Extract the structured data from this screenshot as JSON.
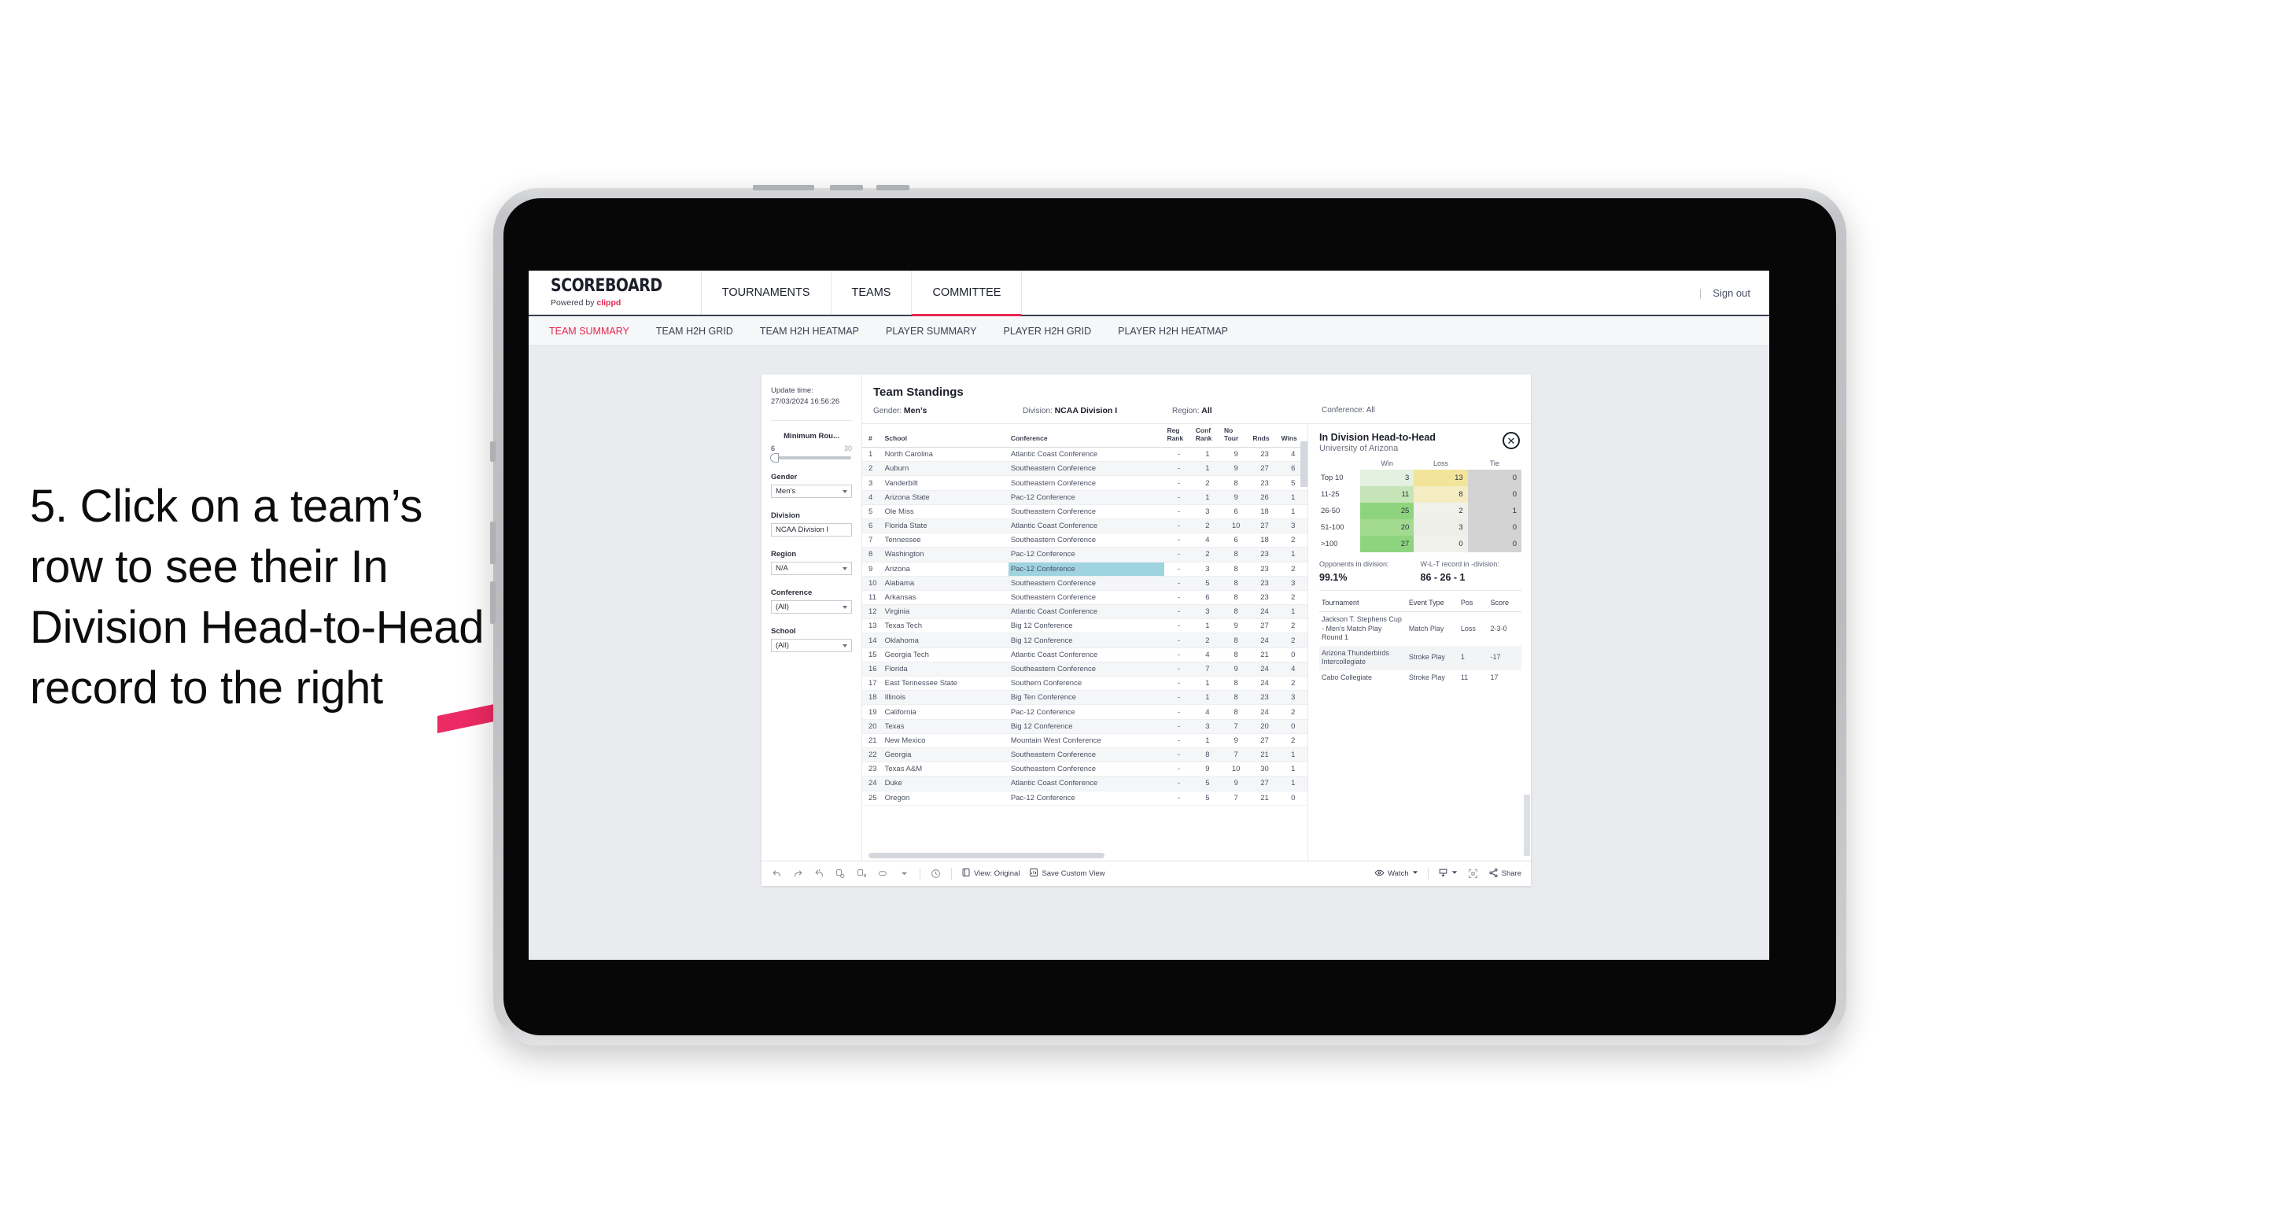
{
  "annotation": {
    "text": "5. Click on a team’s row to see their In Division Head-to-Head record to the right",
    "arrow_color": "#ec2a63"
  },
  "header": {
    "brand_name": "SCOREBOARD",
    "brand_sub_prefix": "Powered by ",
    "brand_sub_accent": "clippd",
    "nav": [
      {
        "label": "TOURNAMENTS",
        "active": false
      },
      {
        "label": "TEAMS",
        "active": false
      },
      {
        "label": "COMMITTEE",
        "active": true
      }
    ],
    "divider": "|",
    "signout": "Sign out",
    "accent_color": "#e8264f"
  },
  "subnav": [
    {
      "label": "TEAM SUMMARY",
      "active": true
    },
    {
      "label": "TEAM H2H GRID",
      "active": false
    },
    {
      "label": "TEAM H2H HEATMAP",
      "active": false
    },
    {
      "label": "PLAYER SUMMARY",
      "active": false
    },
    {
      "label": "PLAYER H2H GRID",
      "active": false
    },
    {
      "label": "PLAYER H2H HEATMAP",
      "active": false
    }
  ],
  "filters": {
    "update_time_label": "Update time:",
    "update_time_value": "27/03/2024 16:56:26",
    "slider": {
      "title": "Minimum Rou...",
      "min": "6",
      "max": "30"
    },
    "fields": [
      {
        "label": "Gender",
        "value": "Men’s"
      },
      {
        "label": "Division",
        "value": "NCAA Division I"
      },
      {
        "label": "Region",
        "value": "N/A"
      },
      {
        "label": "Conference",
        "value": "(All)"
      },
      {
        "label": "School",
        "value": "(All)"
      }
    ]
  },
  "standings": {
    "title": "Team Standings",
    "subfilters": [
      {
        "label": "Gender:",
        "value": "Men’s"
      },
      {
        "label": "Division:",
        "value": "NCAA Division I"
      },
      {
        "label": "Region:",
        "value": "All"
      },
      {
        "label": "Conference:",
        "value": "All"
      }
    ],
    "columns": [
      "#",
      "School",
      "Conference",
      "Reg Rank",
      "Conf Rank",
      "No Tour",
      "Rnds",
      "Wins"
    ],
    "rows": [
      [
        "1",
        "North Carolina",
        "Atlantic Coast Conference",
        "-",
        "1",
        "9",
        "23",
        "4"
      ],
      [
        "2",
        "Auburn",
        "Southeastern Conference",
        "-",
        "1",
        "9",
        "27",
        "6"
      ],
      [
        "3",
        "Vanderbilt",
        "Southeastern Conference",
        "-",
        "2",
        "8",
        "23",
        "5"
      ],
      [
        "4",
        "Arizona State",
        "Pac-12 Conference",
        "-",
        "1",
        "9",
        "26",
        "1"
      ],
      [
        "5",
        "Ole Miss",
        "Southeastern Conference",
        "-",
        "3",
        "6",
        "18",
        "1"
      ],
      [
        "6",
        "Florida State",
        "Atlantic Coast Conference",
        "-",
        "2",
        "10",
        "27",
        "3"
      ],
      [
        "7",
        "Tennessee",
        "Southeastern Conference",
        "-",
        "4",
        "6",
        "18",
        "2"
      ],
      [
        "8",
        "Washington",
        "Pac-12 Conference",
        "-",
        "2",
        "8",
        "23",
        "1"
      ],
      [
        "9",
        "Arizona",
        "Pac-12 Conference",
        "-",
        "3",
        "8",
        "23",
        "2"
      ],
      [
        "10",
        "Alabama",
        "Southeastern Conference",
        "-",
        "5",
        "8",
        "23",
        "3"
      ],
      [
        "11",
        "Arkansas",
        "Southeastern Conference",
        "-",
        "6",
        "8",
        "23",
        "2"
      ],
      [
        "12",
        "Virginia",
        "Atlantic Coast Conference",
        "-",
        "3",
        "8",
        "24",
        "1"
      ],
      [
        "13",
        "Texas Tech",
        "Big 12 Conference",
        "-",
        "1",
        "9",
        "27",
        "2"
      ],
      [
        "14",
        "Oklahoma",
        "Big 12 Conference",
        "-",
        "2",
        "8",
        "24",
        "2"
      ],
      [
        "15",
        "Georgia Tech",
        "Atlantic Coast Conference",
        "-",
        "4",
        "8",
        "21",
        "0"
      ],
      [
        "16",
        "Florida",
        "Southeastern Conference",
        "-",
        "7",
        "9",
        "24",
        "4"
      ],
      [
        "17",
        "East Tennessee State",
        "Southern Conference",
        "-",
        "1",
        "8",
        "24",
        "2"
      ],
      [
        "18",
        "Illinois",
        "Big Ten Conference",
        "-",
        "1",
        "8",
        "23",
        "3"
      ],
      [
        "19",
        "California",
        "Pac-12 Conference",
        "-",
        "4",
        "8",
        "24",
        "2"
      ],
      [
        "20",
        "Texas",
        "Big 12 Conference",
        "-",
        "3",
        "7",
        "20",
        "0"
      ],
      [
        "21",
        "New Mexico",
        "Mountain West Conference",
        "-",
        "1",
        "9",
        "27",
        "2"
      ],
      [
        "22",
        "Georgia",
        "Southeastern Conference",
        "-",
        "8",
        "7",
        "21",
        "1"
      ],
      [
        "23",
        "Texas A&M",
        "Southeastern Conference",
        "-",
        "9",
        "10",
        "30",
        "1"
      ],
      [
        "24",
        "Duke",
        "Atlantic Coast Conference",
        "-",
        "5",
        "9",
        "27",
        "1"
      ],
      [
        "25",
        "Oregon",
        "Pac-12 Conference",
        "-",
        "5",
        "7",
        "21",
        "0"
      ]
    ],
    "selected_row_index": 8,
    "highlight_color": "#9fd3e0"
  },
  "h2h": {
    "title": "In Division Head-to-Head",
    "subtitle": "University of Arizona",
    "close_icon": "close-icon",
    "columns": [
      "",
      "Win",
      "Loss",
      "Tie"
    ],
    "rows": [
      {
        "band": "Top 10",
        "win": "3",
        "loss": "13",
        "tie": "0",
        "win_color": "#e4f0e0",
        "loss_color": "#f2e49a",
        "tie_color": "#d3d3d3"
      },
      {
        "band": "11-25",
        "win": "11",
        "loss": "8",
        "tie": "0",
        "win_color": "#c5e5b8",
        "loss_color": "#f5ecc4",
        "tie_color": "#d3d3d3"
      },
      {
        "band": "26-50",
        "win": "25",
        "loss": "2",
        "tie": "1",
        "win_color": "#8ed47e",
        "loss_color": "#f1f1ec",
        "tie_color": "#d3d3d3"
      },
      {
        "band": "51-100",
        "win": "20",
        "loss": "3",
        "tie": "0",
        "win_color": "#a2da90",
        "loss_color": "#eeeee9",
        "tie_color": "#d3d3d3"
      },
      {
        "band": ">100",
        "win": "27",
        "loss": "0",
        "tie": "0",
        "win_color": "#8ed47e",
        "loss_color": "#f1f1ec",
        "tie_color": "#d3d3d3"
      }
    ],
    "stats": [
      {
        "label": "Opponents in division:",
        "value": "99.1%"
      },
      {
        "label": "W-L-T record in -division:",
        "value": "86 - 26 - 1"
      }
    ],
    "tour_columns": [
      "Tournament",
      "Event Type",
      "Pos",
      "Score"
    ],
    "tour_rows": [
      [
        "Jackson T. Stephens Cup - Men’s Match Play Round 1",
        "Match Play",
        "Loss",
        "2-3-0"
      ],
      [
        "Arizona Thunderbirds Intercollegiate",
        "Stroke Play",
        "1",
        "-17"
      ],
      [
        "Cabo Collegiate",
        "Stroke Play",
        "11",
        "17"
      ]
    ]
  },
  "toolbar": {
    "icons": [
      "undo-icon",
      "redo-icon",
      "revert-icon",
      "refresh-data-icon",
      "pause-updates-icon",
      "view-shape-icon"
    ],
    "clock_icon": "clock-icon",
    "view_label": "View: Original",
    "save_label": "Save Custom View",
    "watch_label": "Watch",
    "share_label": "Share"
  }
}
